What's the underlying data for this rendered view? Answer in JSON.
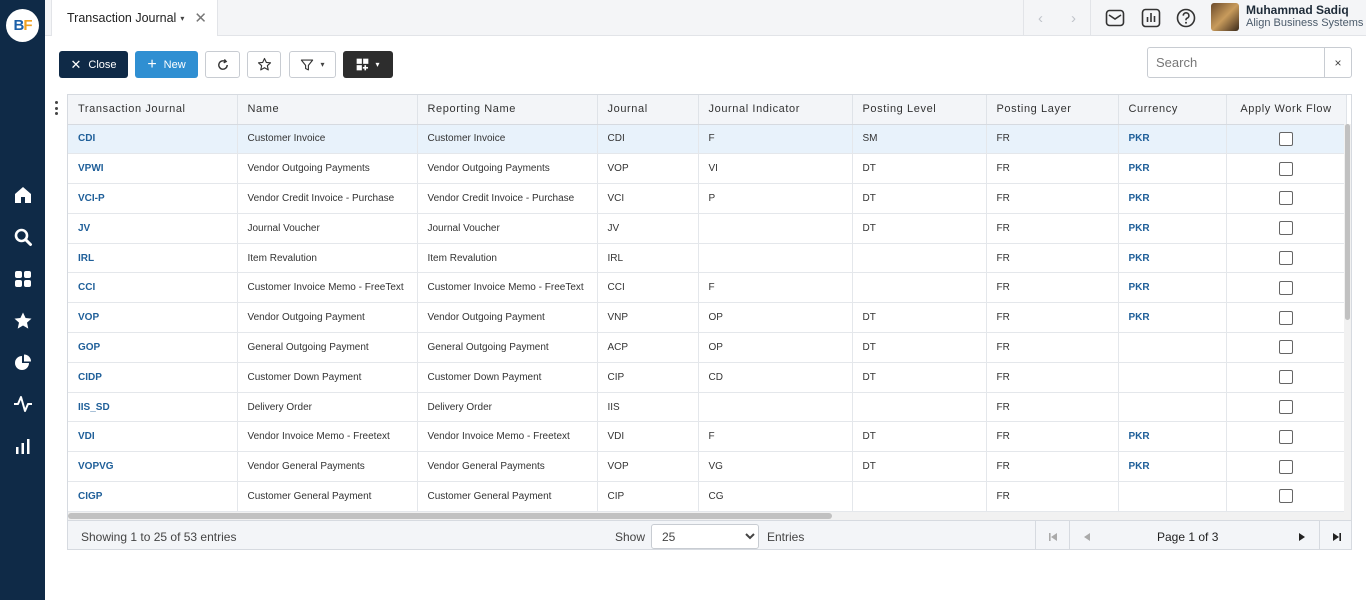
{
  "brand": {
    "logo_b": "B",
    "logo_f": "F"
  },
  "tab": {
    "title": "Transaction Journal",
    "close_glyph": "✕",
    "caret": "▾"
  },
  "nav": {
    "back": "‹",
    "forward": "›"
  },
  "user": {
    "name": "Muhammad Sadiq",
    "org": "Align Business Systems"
  },
  "toolbar": {
    "close_label": "Close",
    "new_label": "New",
    "close_glyph": "✕",
    "new_glyph": "+"
  },
  "search": {
    "placeholder": "Search",
    "clear_glyph": "×"
  },
  "table": {
    "columns": [
      "Transaction Journal",
      "Name",
      "Reporting Name",
      "Journal",
      "Journal Indicator",
      "Posting Level",
      "Posting Layer",
      "Currency",
      "Apply Work Flow"
    ],
    "rows": [
      [
        "CDI",
        "Customer Invoice",
        "Customer Invoice",
        "CDI",
        "F",
        "SM",
        "FR",
        "PKR"
      ],
      [
        "VPWI",
        "Vendor Outgoing Payments",
        "Vendor Outgoing Payments",
        "VOP",
        "VI",
        "DT",
        "FR",
        "PKR"
      ],
      [
        "VCI-P",
        "Vendor Credit Invoice - Purchase",
        "Vendor Credit Invoice - Purchase",
        "VCI",
        "P",
        "DT",
        "FR",
        "PKR"
      ],
      [
        "JV",
        "Journal Voucher",
        "Journal Voucher",
        "JV",
        "",
        "DT",
        "FR",
        "PKR"
      ],
      [
        "IRL",
        "Item Revalution",
        "Item Revalution",
        "IRL",
        "",
        "",
        "FR",
        "PKR"
      ],
      [
        "CCI",
        "Customer Invoice Memo - FreeText",
        "Customer Invoice Memo - FreeText",
        "CCI",
        "F",
        "",
        "FR",
        "PKR"
      ],
      [
        "VOP",
        "Vendor Outgoing Payment",
        "Vendor Outgoing Payment",
        "VNP",
        "OP",
        "DT",
        "FR",
        "PKR"
      ],
      [
        "GOP",
        "General Outgoing Payment",
        "General Outgoing Payment",
        "ACP",
        "OP",
        "DT",
        "FR",
        ""
      ],
      [
        "CIDP",
        "Customer Down Payment",
        "Customer Down Payment",
        "CIP",
        "CD",
        "DT",
        "FR",
        ""
      ],
      [
        "IIS_SD",
        "Delivery Order",
        "Delivery Order",
        "IIS",
        "",
        "",
        "FR",
        ""
      ],
      [
        "VDI",
        "Vendor Invoice Memo - Freetext",
        "Vendor Invoice Memo - Freetext",
        "VDI",
        "F",
        "DT",
        "FR",
        "PKR"
      ],
      [
        "VOPVG",
        "Vendor General Payments",
        "Vendor General Payments",
        "VOP",
        "VG",
        "DT",
        "FR",
        "PKR"
      ],
      [
        "CIGP",
        "Customer General Payment",
        "Customer General Payment",
        "CIP",
        "CG",
        "",
        "FR",
        ""
      ]
    ]
  },
  "footer": {
    "showing": "Showing 1 to 25 of 53 entries",
    "show_label": "Show",
    "page_size": "25",
    "entries_label": "Entries",
    "page_label": "Page 1 of 3"
  },
  "icons": {
    "sidebar": [
      "home-icon",
      "search-icon",
      "apps-grid-icon",
      "star-icon",
      "pie-chart-icon",
      "activity-icon",
      "bar-chart-icon"
    ],
    "topbar": [
      "mail-icon",
      "report-icon",
      "help-icon"
    ]
  },
  "colors": {
    "sidebar": "#0f2a47",
    "primary": "#2f8fd2",
    "link": "#1f5f99"
  }
}
